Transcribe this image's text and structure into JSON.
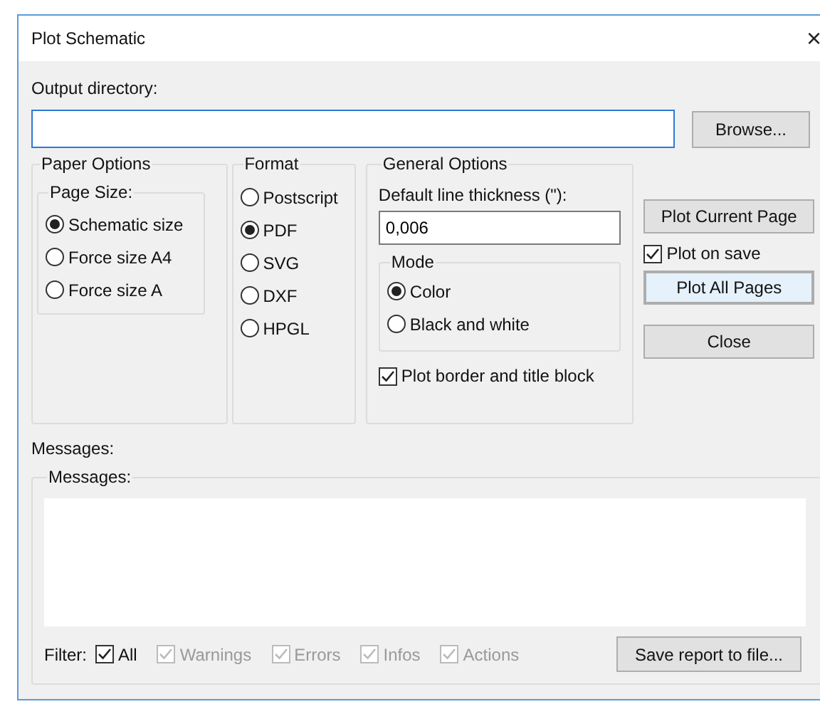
{
  "window": {
    "title": "Plot Schematic",
    "close": "×"
  },
  "output_directory": {
    "label": "Output directory:",
    "browse": "Browse..."
  },
  "paper_options": {
    "title": "Paper Options",
    "page_size": {
      "title": "Page Size:",
      "options": [
        {
          "label": "Schematic size",
          "selected": true
        },
        {
          "label": "Force size A4",
          "selected": false
        },
        {
          "label": "Force size A",
          "selected": false
        }
      ]
    }
  },
  "format": {
    "title": "Format",
    "options": [
      {
        "label": "Postscript",
        "selected": false
      },
      {
        "label": "PDF",
        "selected": true
      },
      {
        "label": "SVG",
        "selected": false
      },
      {
        "label": "DXF",
        "selected": false
      },
      {
        "label": "HPGL",
        "selected": false
      }
    ]
  },
  "general_options": {
    "title": "General Options",
    "line_thickness": {
      "label": "Default line thickness (\"):",
      "value": "0,006"
    },
    "mode": {
      "title": "Mode",
      "options": [
        {
          "label": "Color",
          "selected": true
        },
        {
          "label": "Black and white",
          "selected": false
        }
      ]
    },
    "plot_border": {
      "label": "Plot border and title block",
      "checked": true
    }
  },
  "actions": {
    "plot_current": "Plot Current Page",
    "plot_on_save": {
      "label": "Plot on save",
      "checked": true
    },
    "plot_all": {
      "label": "Plot All Pages",
      "focused": true
    },
    "close": "Close"
  },
  "messages": {
    "label": "Messages:",
    "group_title": "Messages:",
    "filter_label": "Filter:",
    "filters": [
      {
        "label": "All",
        "checked": true,
        "disabled": false
      },
      {
        "label": "Warnings",
        "checked": true,
        "disabled": true
      },
      {
        "label": "Errors",
        "checked": true,
        "disabled": true
      },
      {
        "label": "Infos",
        "checked": true,
        "disabled": true
      },
      {
        "label": "Actions",
        "checked": true,
        "disabled": true
      }
    ],
    "save_report": "Save report to file..."
  }
}
